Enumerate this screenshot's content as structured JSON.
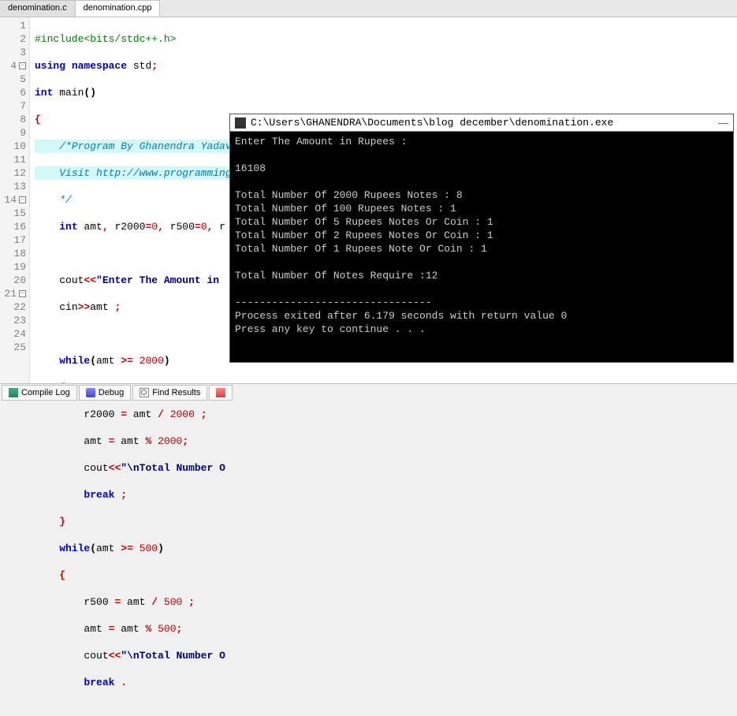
{
  "tabs": {
    "inactive": "denomination.c",
    "active": "denomination.cpp"
  },
  "lines": [
    "1",
    "2",
    "3",
    "4",
    "5",
    "6",
    "7",
    "8",
    "9",
    "10",
    "11",
    "12",
    "13",
    "14",
    "15",
    "16",
    "17",
    "18",
    "19",
    "20",
    "21",
    "22",
    "23",
    "24",
    "25"
  ],
  "code": {
    "l1_pre": "#include<bits/stdc++.h>",
    "l2_kw1": "using",
    "l2_kw2": "namespace",
    "l2_t": " std",
    "l3_kw": "int",
    "l3_t": " main",
    "l5_c": "/*Program By Ghanendra Yadav",
    "l6_c": "Visit http://www.programmingwithbasics.com/",
    "l7_c": "*/",
    "l8_kw": "int",
    "l8_t1": " amt",
    "l8_t2": " r2000",
    "l8_t3": " r500",
    "l8_t4": " r",
    "l8_z": "0",
    "l10_t": "cout",
    "l10_op": "<<",
    "l10_s": "\"Enter The Amount in ",
    "l11_t": "cin",
    "l11_op": ">>",
    "l11_t2": "amt ",
    "l13_kw": "while",
    "l13_t": "amt ",
    "l13_op": ">=",
    "l13_n": "2000",
    "l15_t1": "r2000 ",
    "l15_t2": " amt ",
    "l15_op": "/",
    "l15_n": "2000",
    "l16_t1": "amt ",
    "l16_t2": " amt ",
    "l16_op": "%",
    "l16_n": "2000",
    "l17_t": "cout",
    "l17_op": "<<",
    "l17_s": "\"\\nTotal Number O",
    "l18_kw": "break",
    "l20_kw": "while",
    "l20_t": "amt ",
    "l20_op": ">=",
    "l20_n": "500",
    "l22_t1": "r500 ",
    "l22_t2": " amt ",
    "l22_op": "/",
    "l22_n": "500",
    "l23_t1": "amt ",
    "l23_t2": " amt ",
    "l23_op": "%",
    "l23_n": "500",
    "l24_t": "cout",
    "l24_op": "<<",
    "l24_s": "\"\\nTotal Number O",
    "l25_kw": "break"
  },
  "console": {
    "title": "C:\\Users\\GHANENDRA\\Documents\\blog december\\denomination.exe",
    "body": "Enter The Amount in Rupees :\n\n16108\n\nTotal Number Of 2000 Rupees Notes : 8\nTotal Number Of 100 Rupees Notes : 1\nTotal Number Of 5 Rupees Notes Or Coin : 1\nTotal Number Of 2 Rupees Notes Or Coin : 1\nTotal Number Of 1 Rupees Note Or Coin : 1\n\nTotal Number Of Notes Require :12\n\n--------------------------------\nProcess exited after 6.179 seconds with return value 0\nPress any key to continue . . ."
  },
  "bottom": {
    "compile": "Compile Log",
    "debug": "Debug",
    "find": "Find Results"
  }
}
